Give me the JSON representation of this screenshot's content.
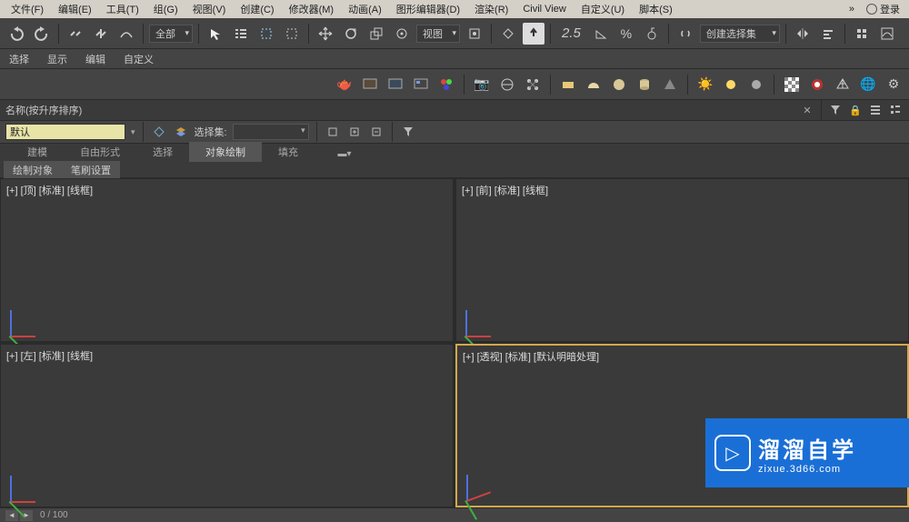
{
  "menu": {
    "file": "文件(F)",
    "edit": "编辑(E)",
    "tools": "工具(T)",
    "group": "组(G)",
    "views": "视图(V)",
    "create": "创建(C)",
    "modifiers": "修改器(M)",
    "animation": "动画(A)",
    "graph": "图形编辑器(D)",
    "rendering": "渲染(R)",
    "civil": "Civil View",
    "customize": "自定义(U)",
    "script": "脚本(S)",
    "login": "登录"
  },
  "toolbar1": {
    "filter_all": "全部",
    "view_dropdown": "视图",
    "scale_value": "2.5",
    "create_sel_set": "创建选择集"
  },
  "toolbar2": {
    "select": "选择",
    "display": "显示",
    "edit": "编辑",
    "customize": "自定义"
  },
  "name_sort": "名称(按升序排序)",
  "name_default": "默认",
  "selset_label": "选择集:",
  "ribbon": {
    "tabs": [
      "建模",
      "自由形式",
      "选择",
      "对象绘制",
      "填充"
    ],
    "subtabs": [
      "绘制对象",
      "笔刷设置"
    ]
  },
  "viewports": {
    "top": "[+] [顶] [标准] [线框]",
    "front": "[+] [前] [标准] [线框]",
    "left": "[+] [左] [标准] [线框]",
    "persp": "[+] [透视] [标准] [默认明暗处理]"
  },
  "status": {
    "frame": "0 / 100"
  },
  "watermark": {
    "title": "溜溜自学",
    "sub": "zixue.3d66.com"
  }
}
